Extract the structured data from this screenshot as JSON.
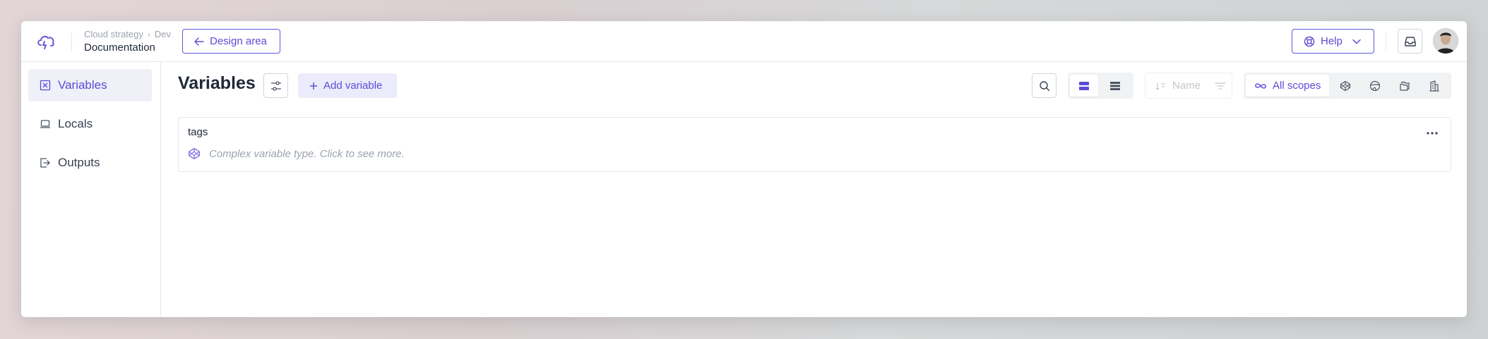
{
  "header": {
    "breadcrumb": {
      "parent": "Cloud strategy",
      "current": "Dev"
    },
    "subtitle": "Documentation",
    "back_button_label": "Design area",
    "help_label": "Help"
  },
  "sidebar": {
    "items": [
      {
        "label": "Variables",
        "icon": "variable-icon",
        "active": true
      },
      {
        "label": "Locals",
        "icon": "laptop-icon",
        "active": false
      },
      {
        "label": "Outputs",
        "icon": "output-icon",
        "active": false
      }
    ]
  },
  "main": {
    "title": "Variables",
    "add_label": "Add variable",
    "sort_label": "Name",
    "scope_all_label": "All scopes",
    "variables": [
      {
        "name": "tags",
        "description": "Complex variable type. Click to see more."
      }
    ]
  },
  "colors": {
    "accent": "#5b4bd6",
    "border": "#e5e7eb"
  }
}
